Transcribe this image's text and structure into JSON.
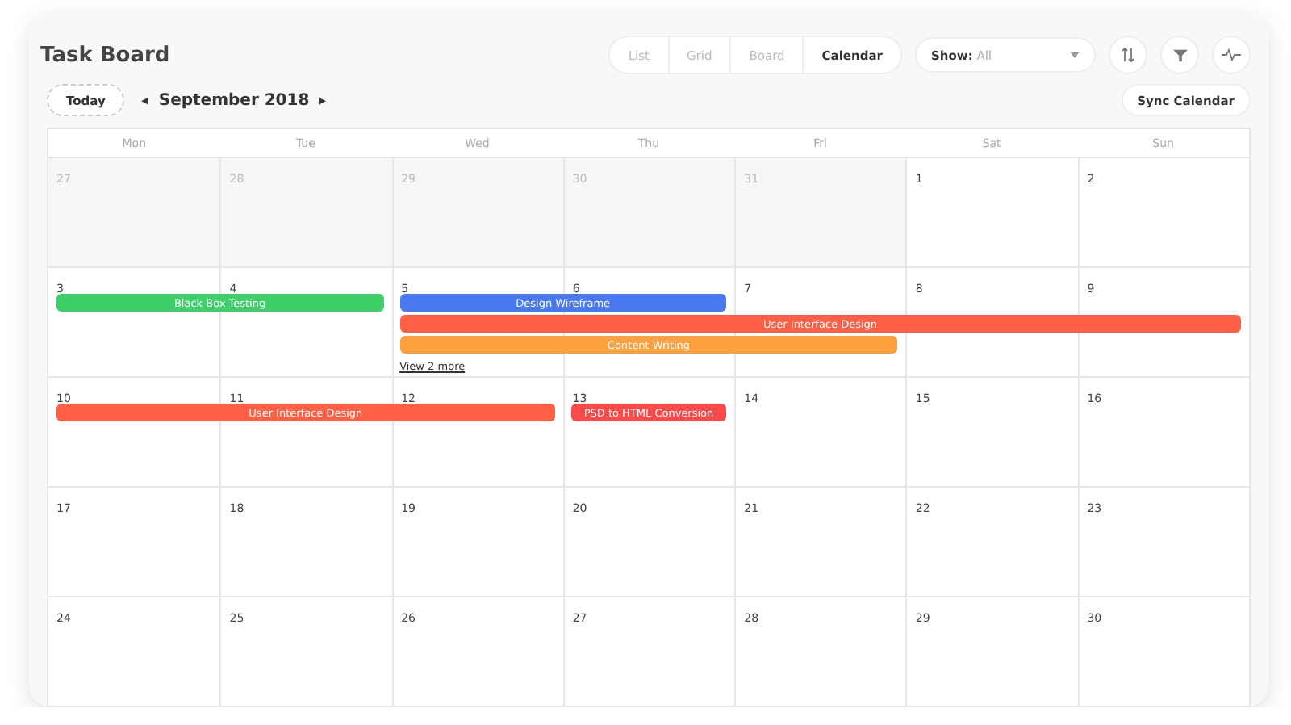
{
  "title": "Task Board",
  "view_tabs": [
    {
      "label": "List",
      "selected": false
    },
    {
      "label": "Grid",
      "selected": false
    },
    {
      "label": "Board",
      "selected": false
    },
    {
      "label": "Calendar",
      "selected": true
    }
  ],
  "show_select": {
    "label": "Show:",
    "value": "All"
  },
  "today_button": "Today",
  "month": {
    "prev": "◂",
    "label": "September 2018",
    "next": "▸"
  },
  "sync_button": "Sync Calendar",
  "weekdays": [
    "Mon",
    "Tue",
    "Wed",
    "Thu",
    "Fri",
    "Sat",
    "Sun"
  ],
  "weeks": [
    {
      "days": [
        {
          "number": "27",
          "outside": true
        },
        {
          "number": "28",
          "outside": true
        },
        {
          "number": "29",
          "outside": true
        },
        {
          "number": "30",
          "outside": true
        },
        {
          "number": "31",
          "outside": true
        },
        {
          "number": "1",
          "outside": false
        },
        {
          "number": "2",
          "outside": false
        }
      ]
    },
    {
      "days": [
        {
          "number": "3",
          "outside": false,
          "events": [
            {
              "title": "Black Box Testing",
              "color": "#3ecf6b"
            }
          ]
        },
        {
          "number": "4",
          "outside": false,
          "events": [
            {
              "continued": true
            }
          ]
        },
        {
          "number": "5",
          "outside": false,
          "events": [
            {
              "title": "Design Wireframe",
              "color": "#4a78f0"
            },
            {
              "title": "User Interface Design",
              "color": "#ff5f45"
            },
            {
              "title": "Content Writing",
              "color": "#ffa040"
            }
          ],
          "more": "View 2 more"
        },
        {
          "number": "6",
          "outside": false,
          "events": [
            {
              "continued": true
            },
            {
              "continued": true
            },
            {
              "continued": true
            }
          ]
        },
        {
          "number": "7",
          "outside": false,
          "events": [
            {
              "continued": false
            },
            {
              "continued": true
            },
            {
              "continued": true
            }
          ]
        },
        {
          "number": "8",
          "outside": false,
          "events": [
            {
              "continued": false
            },
            {
              "continued": true
            }
          ]
        },
        {
          "number": "9",
          "outside": false,
          "events": [
            {
              "continued": false
            },
            {
              "continued": true
            }
          ]
        }
      ]
    },
    {
      "days": [
        {
          "number": "10",
          "outside": false,
          "events": [
            {
              "title": "User Interface Design",
              "color": "#ff5f45"
            }
          ]
        },
        {
          "number": "11",
          "outside": false,
          "events": [
            {
              "continued": true
            }
          ]
        },
        {
          "number": "12",
          "outside": false,
          "events": [
            {
              "continued": true
            }
          ]
        },
        {
          "number": "13",
          "outside": false,
          "events": [
            {
              "title": "PSD to HTML Conversion",
              "color": "#fa4a4a"
            }
          ]
        },
        {
          "number": "14",
          "outside": false
        },
        {
          "number": "15",
          "outside": false
        },
        {
          "number": "16",
          "outside": false
        }
      ]
    },
    {
      "days": [
        {
          "number": "17",
          "outside": false
        },
        {
          "number": "18",
          "outside": false
        },
        {
          "number": "19",
          "outside": false
        },
        {
          "number": "20",
          "outside": false
        },
        {
          "number": "21",
          "outside": false
        },
        {
          "number": "22",
          "outside": false
        },
        {
          "number": "23",
          "outside": false
        }
      ]
    },
    {
      "days": [
        {
          "number": "24",
          "outside": false
        },
        {
          "number": "25",
          "outside": false
        },
        {
          "number": "26",
          "outside": false
        },
        {
          "number": "27",
          "outside": false
        },
        {
          "number": "28",
          "outside": false
        },
        {
          "number": "29",
          "outside": false
        },
        {
          "number": "30",
          "outside": false
        }
      ]
    }
  ]
}
